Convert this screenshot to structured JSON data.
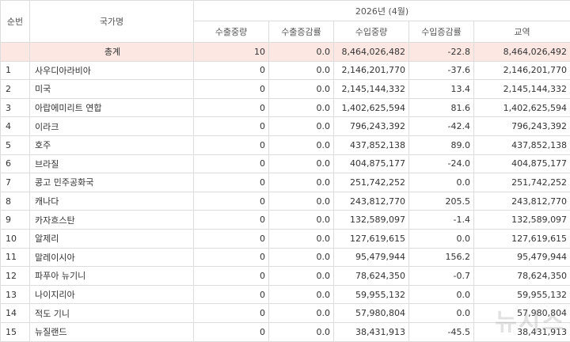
{
  "header": {
    "rank": "순번",
    "country": "국가명",
    "period": "2026년 (4월)",
    "cols": [
      "수출중량",
      "수출증감률",
      "수입중량",
      "수입증감률",
      "교역"
    ]
  },
  "total": {
    "label": "총계",
    "values": [
      "10",
      "0.0",
      "8,464,026,482",
      "-22.8",
      "8,464,026,492"
    ]
  },
  "rows": [
    {
      "rank": "1",
      "country": "사우디아라비아",
      "values": [
        "0",
        "0.0",
        "2,146,201,770",
        "-37.6",
        "2,146,201,770"
      ]
    },
    {
      "rank": "2",
      "country": "미국",
      "values": [
        "0",
        "0.0",
        "2,145,144,332",
        "13.4",
        "2,145,144,332"
      ]
    },
    {
      "rank": "3",
      "country": "아랍에미리트 연합",
      "values": [
        "0",
        "0.0",
        "1,402,625,594",
        "81.6",
        "1,402,625,594"
      ]
    },
    {
      "rank": "4",
      "country": "이라크",
      "values": [
        "0",
        "0.0",
        "796,243,392",
        "-42.4",
        "796,243,392"
      ]
    },
    {
      "rank": "5",
      "country": "호주",
      "values": [
        "0",
        "0.0",
        "437,852,138",
        "89.0",
        "437,852,138"
      ]
    },
    {
      "rank": "6",
      "country": "브라질",
      "values": [
        "0",
        "0.0",
        "404,875,177",
        "-24.0",
        "404,875,177"
      ]
    },
    {
      "rank": "7",
      "country": "콩고 민주공화국",
      "values": [
        "0",
        "0.0",
        "251,742,252",
        "0.0",
        "251,742,252"
      ]
    },
    {
      "rank": "8",
      "country": "캐나다",
      "values": [
        "0",
        "0.0",
        "243,812,770",
        "205.5",
        "243,812,770"
      ]
    },
    {
      "rank": "9",
      "country": "카자흐스탄",
      "values": [
        "0",
        "0.0",
        "132,589,097",
        "-1.4",
        "132,589,097"
      ]
    },
    {
      "rank": "10",
      "country": "알제리",
      "values": [
        "0",
        "0.0",
        "127,619,615",
        "0.0",
        "127,619,615"
      ]
    },
    {
      "rank": "11",
      "country": "말레이시아",
      "values": [
        "0",
        "0.0",
        "95,479,944",
        "156.2",
        "95,479,944"
      ]
    },
    {
      "rank": "12",
      "country": "파푸아 뉴기니",
      "values": [
        "0",
        "0.0",
        "78,624,350",
        "-0.7",
        "78,624,350"
      ]
    },
    {
      "rank": "13",
      "country": "나이지리아",
      "values": [
        "0",
        "0.0",
        "59,955,132",
        "0.0",
        "59,955,132"
      ]
    },
    {
      "rank": "14",
      "country": "적도 기니",
      "values": [
        "0",
        "0.0",
        "57,980,804",
        "0.0",
        "57,980,804"
      ]
    },
    {
      "rank": "15",
      "country": "뉴질랜드",
      "values": [
        "0",
        "0.0",
        "38,431,913",
        "-45.5",
        "38,431,913"
      ]
    }
  ],
  "watermark": "뉴시스"
}
